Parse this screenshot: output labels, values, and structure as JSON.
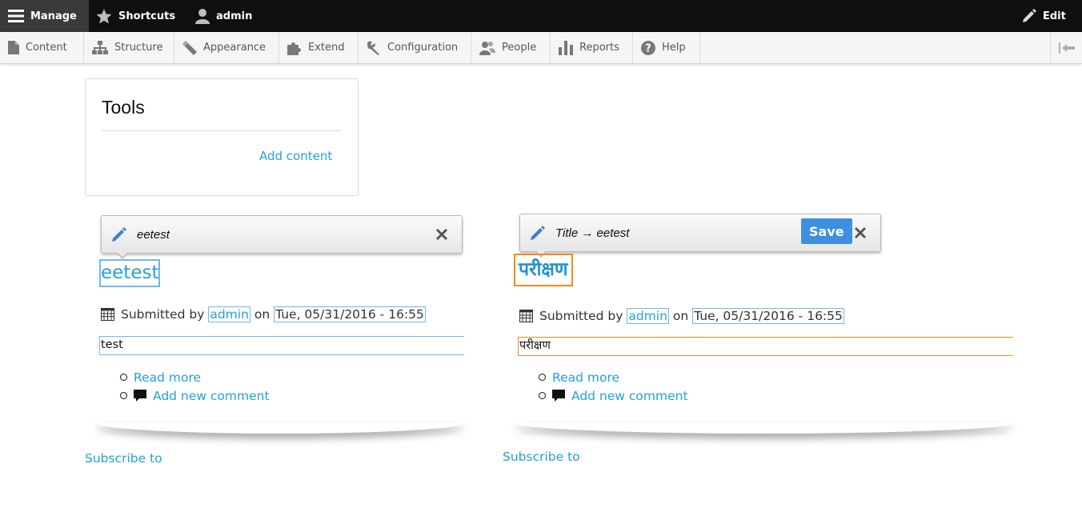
{
  "toolbar": {
    "manage": "Manage",
    "shortcuts": "Shortcuts",
    "user": "admin",
    "edit": "Edit"
  },
  "tray": {
    "items": [
      {
        "label": "Content",
        "icon": "file-icon"
      },
      {
        "label": "Structure",
        "icon": "sitemap-icon"
      },
      {
        "label": "Appearance",
        "icon": "brush-icon"
      },
      {
        "label": "Extend",
        "icon": "puzzle-icon"
      },
      {
        "label": "Configuration",
        "icon": "wrench-icon"
      },
      {
        "label": "People",
        "icon": "people-icon"
      },
      {
        "label": "Reports",
        "icon": "bar-chart-icon"
      },
      {
        "label": "Help",
        "icon": "help-icon"
      }
    ]
  },
  "tools": {
    "title": "Tools",
    "add_content": "Add content"
  },
  "left_article": {
    "editor_label": "eetest",
    "title": "eetest",
    "submitted_by": "Submitted by",
    "author": "admin",
    "on": "on",
    "date": "Tue, 05/31/2016 - 16:55",
    "body": "test",
    "read_more": "Read more",
    "add_comment": "Add new comment",
    "subscribe": "Subscribe to"
  },
  "right_article": {
    "editor_label": "Title → eetest",
    "save": "Save",
    "title": "परीक्षण",
    "submitted_by": "Submitted by",
    "author": "admin",
    "on": "on",
    "date": "Tue, 05/31/2016 - 16:55",
    "body": "परीक्षण",
    "read_more": "Read more",
    "add_comment": "Add new comment",
    "subscribe": "Subscribe to"
  },
  "colors": {
    "link": "#26a0d6",
    "active_outline": "#f28a1b",
    "hover_outline": "#6fb7ef",
    "save_button": "#3f8fe0"
  }
}
